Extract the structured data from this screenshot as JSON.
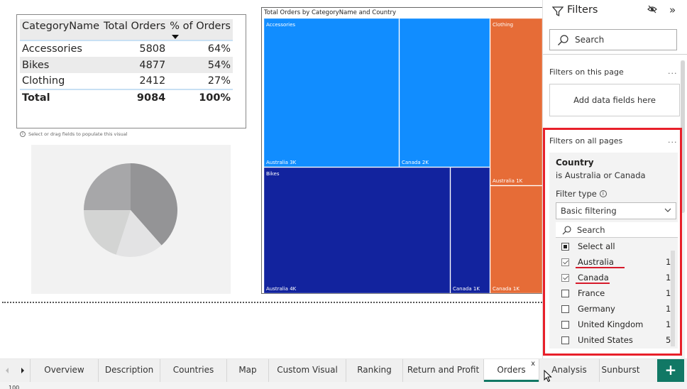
{
  "table": {
    "columns": [
      "CategoryName",
      "Total Orders",
      "% of Orders"
    ],
    "rows": [
      {
        "category": "Accessories",
        "orders": "5808",
        "pct": "64%"
      },
      {
        "category": "Bikes",
        "orders": "4877",
        "pct": "54%"
      },
      {
        "category": "Clothing",
        "orders": "2412",
        "pct": "27%"
      }
    ],
    "total": {
      "label": "Total",
      "orders": "9084",
      "pct": "100%"
    }
  },
  "pie_placeholder": {
    "hint": "Select or drag fields to populate this visual",
    "colors": [
      "#949496",
      "#e3e3e4",
      "#d3d4d3",
      "#a7a7a9"
    ]
  },
  "treemap": {
    "title": "Total Orders by CategoryName and Country",
    "categories": [
      {
        "name": "Accessories",
        "color": "#118dff",
        "countries": [
          {
            "name": "Australia",
            "label": "Australia 3K"
          },
          {
            "name": "Canada",
            "label": "Canada 2K"
          }
        ]
      },
      {
        "name": "Bikes",
        "color": "#12239e",
        "countries": [
          {
            "name": "Australia",
            "label": "Australia 4K"
          },
          {
            "name": "Canada",
            "label": "Canada 1K"
          }
        ]
      },
      {
        "name": "Clothing",
        "color": "#e66c37",
        "countries": [
          {
            "name": "Australia",
            "label": "Australia 1K"
          },
          {
            "name": "Canada",
            "label": "Canada 1K"
          }
        ]
      }
    ]
  },
  "filters": {
    "title": "Filters",
    "search_placeholder": "Search",
    "this_page_title": "Filters on this page",
    "add_fields": "Add data fields here",
    "all_pages_title": "Filters on all pages",
    "ellipsis": "...",
    "card": {
      "field": "Country",
      "description": "is Australia or Canada",
      "filter_type_label": "Filter type",
      "filter_type_value": "Basic filtering",
      "search_placeholder": "Search",
      "values": [
        {
          "name": "Select all",
          "count": "",
          "state": "partial"
        },
        {
          "name": "Australia",
          "count": "1",
          "state": "checked"
        },
        {
          "name": "Canada",
          "count": "1",
          "state": "checked"
        },
        {
          "name": "France",
          "count": "1",
          "state": "unchecked"
        },
        {
          "name": "Germany",
          "count": "1",
          "state": "unchecked"
        },
        {
          "name": "United Kingdom",
          "count": "1",
          "state": "unchecked"
        },
        {
          "name": "United States",
          "count": "5",
          "state": "unchecked"
        }
      ]
    },
    "highlight_color": "#e8202a"
  },
  "tabs": {
    "items": [
      "Overview",
      "Description",
      "Countries",
      "Map",
      "Custom Visual",
      "Ranking",
      "Return and Profit",
      "Orders",
      "Analysis",
      "Sunburst"
    ],
    "active": "Orders",
    "close_label": "x",
    "add_label": "+",
    "accent": "#117865"
  },
  "status": {
    "text": "100"
  }
}
